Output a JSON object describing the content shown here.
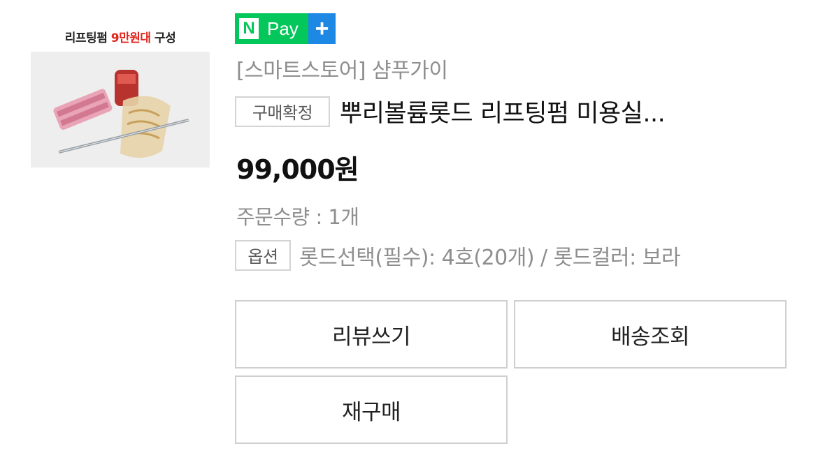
{
  "thumbnail": {
    "caption_prefix": "리프팅펌 ",
    "caption_highlight": "9만원대",
    "caption_suffix": " 구성"
  },
  "npay": {
    "n": "N",
    "label": "Pay",
    "plus": "+"
  },
  "store_name": "[스마트스토어] 샴푸가이",
  "order": {
    "status_badge": "구매확정",
    "product_title": "뿌리볼륨롯드 리프팅펌 미용실...",
    "price": "99,000원",
    "quantity": "주문수량 : 1개",
    "option_badge": "옵션",
    "option_text": "롯드선택(필수): 4호(20개) / 롯드컬러: 보라"
  },
  "buttons": {
    "review": "리뷰쓰기",
    "track": "배송조회",
    "rebuy": "재구매"
  },
  "colors": {
    "npay_green": "#03c75a",
    "npay_blue": "#1e88e5",
    "caption_red": "#e0261d"
  }
}
